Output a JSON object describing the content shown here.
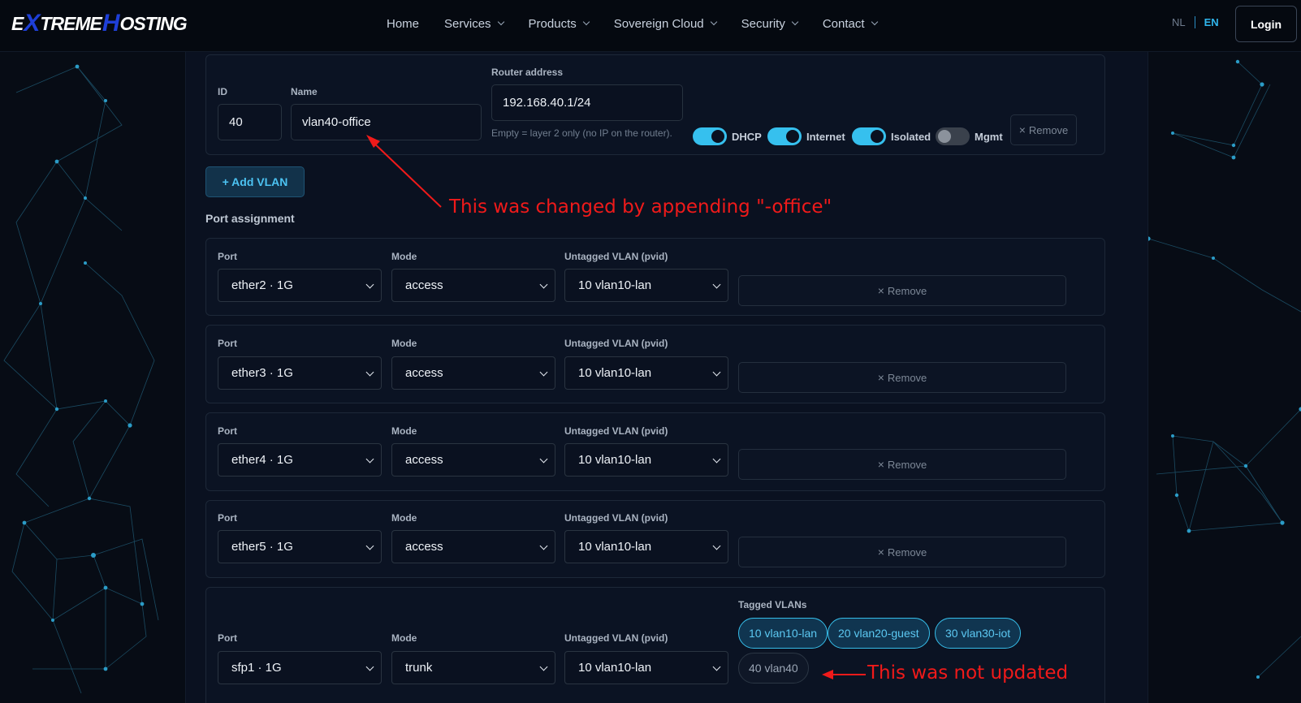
{
  "header": {
    "logo_text": "EXTREME HOSTING",
    "nav": [
      {
        "label": "Home",
        "dropdown": false
      },
      {
        "label": "Services",
        "dropdown": true
      },
      {
        "label": "Products",
        "dropdown": true
      },
      {
        "label": "Sovereign Cloud",
        "dropdown": true
      },
      {
        "label": "Security",
        "dropdown": true
      },
      {
        "label": "Contact",
        "dropdown": true
      }
    ],
    "lang_nl": "NL",
    "lang_en": "EN",
    "login": "Login"
  },
  "vlan": {
    "id_label": "ID",
    "id_value": "40",
    "name_label": "Name",
    "name_value": "vlan40-office",
    "router_label": "Router address",
    "router_value": "192.168.40.1/24",
    "router_hint": "Empty = layer 2 only (no IP on the router).",
    "toggles": [
      {
        "label": "DHCP",
        "on": true
      },
      {
        "label": "Internet",
        "on": true
      },
      {
        "label": "Isolated",
        "on": true
      },
      {
        "label": "Mgmt",
        "on": false
      }
    ],
    "remove": "Remove"
  },
  "add_vlan": "+ Add VLAN",
  "port_assignment": {
    "title": "Port assignment",
    "port_label": "Port",
    "mode_label": "Mode",
    "pvid_label": "Untagged VLAN (pvid)",
    "tagged_label": "Tagged VLANs",
    "remove": "Remove",
    "rows": [
      {
        "port": "ether2 · 1G",
        "mode": "access",
        "pvid": "10 vlan10-lan"
      },
      {
        "port": "ether3 · 1G",
        "mode": "access",
        "pvid": "10 vlan10-lan"
      },
      {
        "port": "ether4 · 1G",
        "mode": "access",
        "pvid": "10 vlan10-lan"
      },
      {
        "port": "ether5 · 1G",
        "mode": "access",
        "pvid": "10 vlan10-lan"
      },
      {
        "port": "sfp1 · 1G",
        "mode": "trunk",
        "pvid": "10 vlan10-lan"
      }
    ],
    "tagged": [
      {
        "label": "10 vlan10-lan",
        "selected": true
      },
      {
        "label": "20 vlan20-guest",
        "selected": true
      },
      {
        "label": "30 vlan30-iot",
        "selected": true
      },
      {
        "label": "40 vlan40",
        "selected": false
      }
    ]
  },
  "annotations": {
    "name_changed": "This was changed by appending \"-office\"",
    "not_updated": "This was not updated",
    "color": "#f01a1a"
  },
  "colors": {
    "accent": "#36c0ee",
    "background": "#070c15",
    "panel": "#0a1120"
  }
}
